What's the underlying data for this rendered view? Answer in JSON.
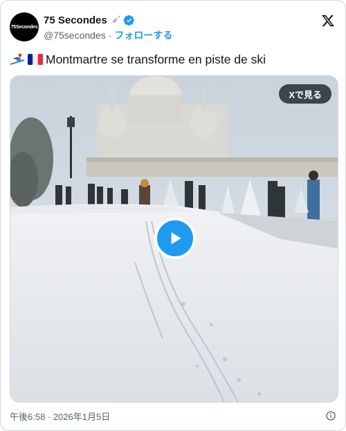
{
  "author": {
    "display_name": "75 Secondes",
    "handle": "@75secondes",
    "separator": "·",
    "follow_label": "フォローする",
    "avatar_text": "75Secondes"
  },
  "tweet": {
    "text": "Montmartre se transforme en piste de ski",
    "emoji_1": "skier-icon",
    "emoji_2": "flag-france-icon"
  },
  "media": {
    "view_on_x_label": "Xで見る",
    "play_icon": "play-icon"
  },
  "footer": {
    "timestamp": "午後6:58 · 2026年1月5日"
  },
  "colors": {
    "accent": "#1d9bf0",
    "text": "#0f1419",
    "muted": "#536471"
  }
}
